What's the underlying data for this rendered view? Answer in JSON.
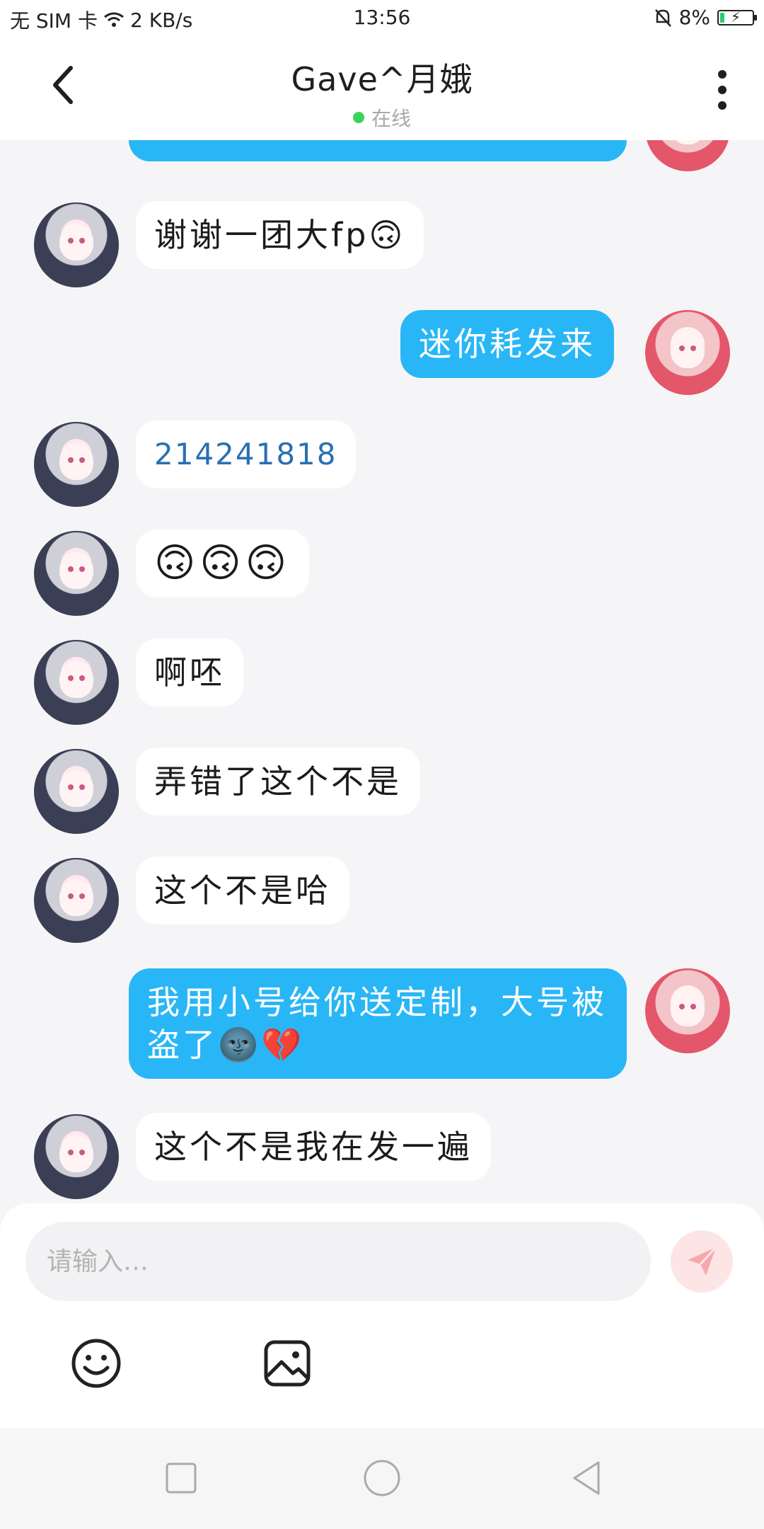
{
  "status": {
    "carrier": "无 SIM 卡",
    "speed": "2 KB/s",
    "time": "13:56",
    "battery": "8%"
  },
  "header": {
    "title": "Gave^月娥",
    "status": "在线"
  },
  "messages": [
    {
      "side": "other",
      "text": "谢谢一团大fp🙃"
    },
    {
      "side": "self",
      "text": "迷你耗发来"
    },
    {
      "side": "other",
      "text": "214241818"
    },
    {
      "side": "other",
      "text": "🙃🙃🙃"
    },
    {
      "side": "other",
      "text": "啊呸"
    },
    {
      "side": "other",
      "text": "弄错了这个不是"
    },
    {
      "side": "other",
      "text": "这个不是哈"
    },
    {
      "side": "self",
      "text": "我用小号给你送定制，大号被盗了🌚💔"
    },
    {
      "side": "other",
      "text": "这个不是我在发一遍"
    }
  ],
  "input": {
    "placeholder": "请输入…"
  },
  "icons": {
    "back": "chevron-left-icon",
    "more": "more-vertical-icon",
    "send": "send-icon",
    "emoji": "smiley-icon",
    "image": "image-icon"
  },
  "colors": {
    "self_bubble": "#29b6f6",
    "other_bubble": "#ffffff",
    "online": "#3ad35a",
    "send_bg": "#fde5e6"
  }
}
